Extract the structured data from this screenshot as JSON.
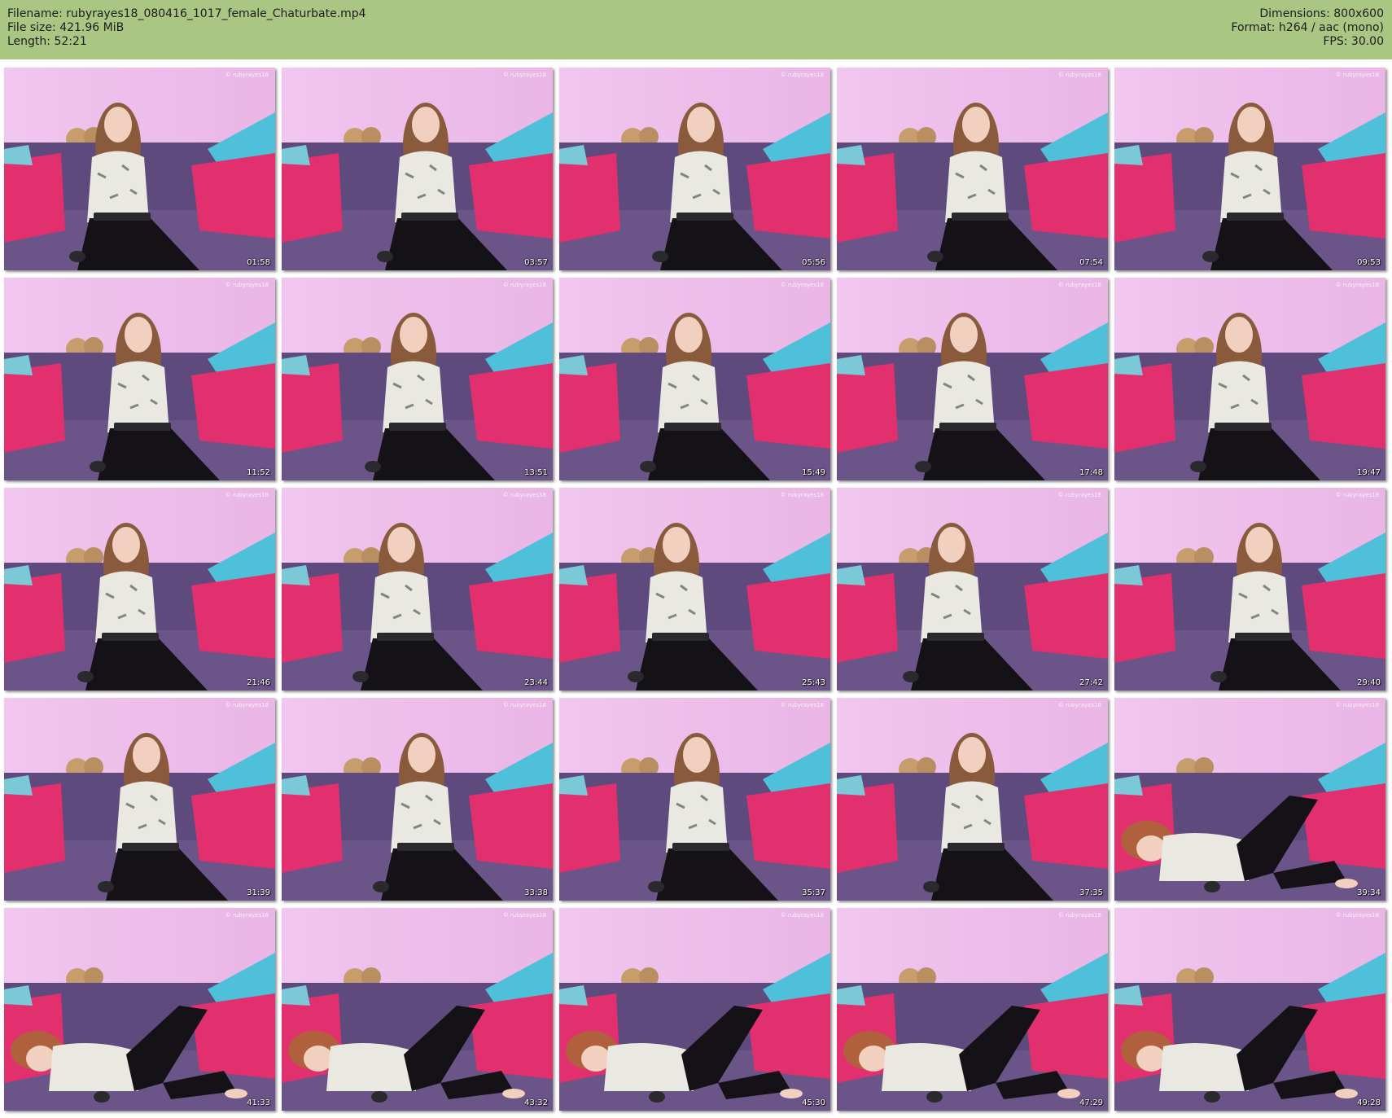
{
  "header": {
    "filename": "Filename: rubyrayes18_080416_1017_female_Chaturbate.mp4",
    "filesize": "File size: 421.96 MiB",
    "length": "Length: 52:21",
    "dimensions": "Dimensions: 800x600",
    "format": "Format: h264 / aac (mono)",
    "fps": "FPS: 30.00"
  },
  "colors": {
    "header_bg": "#a9c783",
    "wall": "#e9b6e6",
    "sofa": "#5f4a7d",
    "pillow_pink": "#e2306f",
    "pillow_blue": "#4ec0da"
  },
  "thumbnails": [
    {
      "timestamp": "01:58"
    },
    {
      "timestamp": "03:57"
    },
    {
      "timestamp": "05:56"
    },
    {
      "timestamp": "07:54"
    },
    {
      "timestamp": "09:53"
    },
    {
      "timestamp": "11:52"
    },
    {
      "timestamp": "13:51"
    },
    {
      "timestamp": "15:49"
    },
    {
      "timestamp": "17:48"
    },
    {
      "timestamp": "19:47"
    },
    {
      "timestamp": "21:46"
    },
    {
      "timestamp": "23:44"
    },
    {
      "timestamp": "25:43"
    },
    {
      "timestamp": "27:42"
    },
    {
      "timestamp": "29:40"
    },
    {
      "timestamp": "31:39"
    },
    {
      "timestamp": "33:38"
    },
    {
      "timestamp": "35:37"
    },
    {
      "timestamp": "37:35"
    },
    {
      "timestamp": "39:34"
    },
    {
      "timestamp": "41:33"
    },
    {
      "timestamp": "43:32"
    },
    {
      "timestamp": "45:30"
    },
    {
      "timestamp": "47:29"
    },
    {
      "timestamp": "49:28"
    }
  ]
}
